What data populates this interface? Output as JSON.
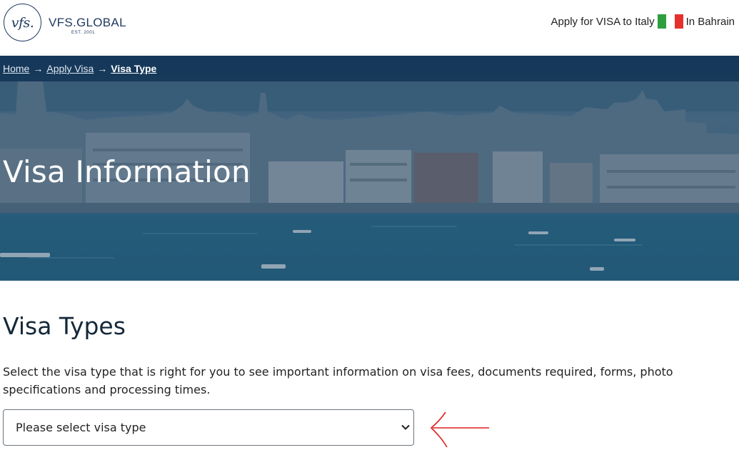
{
  "header": {
    "logo_mark": "vfs.",
    "logo_text": "VFS.GLOBAL",
    "logo_est": "EST. 2001",
    "apply_text": "Apply for VISA to Italy",
    "location_text": "In Bahrain",
    "flag_colors": [
      "#2f9e3f",
      "#ffffff",
      "#e5312c"
    ]
  },
  "breadcrumb": {
    "items": [
      {
        "label": "Home"
      },
      {
        "label": "Apply Visa"
      }
    ],
    "current": "Visa Type",
    "separator": "→"
  },
  "hero": {
    "title": "Visa Information"
  },
  "content": {
    "section_title": "Visa Types",
    "description": "Select the visa type that is right for you to see important information on visa fees, documents required, forms, photo specifications and processing times.",
    "select_value": "Please select visa type"
  },
  "colors": {
    "brand": "#1e3a5f",
    "breadcrumb_bg": "#123456",
    "annotation": "#e02020"
  },
  "icons": {
    "select": "chevron-down-icon",
    "annotation": "arrow-left-icon"
  }
}
